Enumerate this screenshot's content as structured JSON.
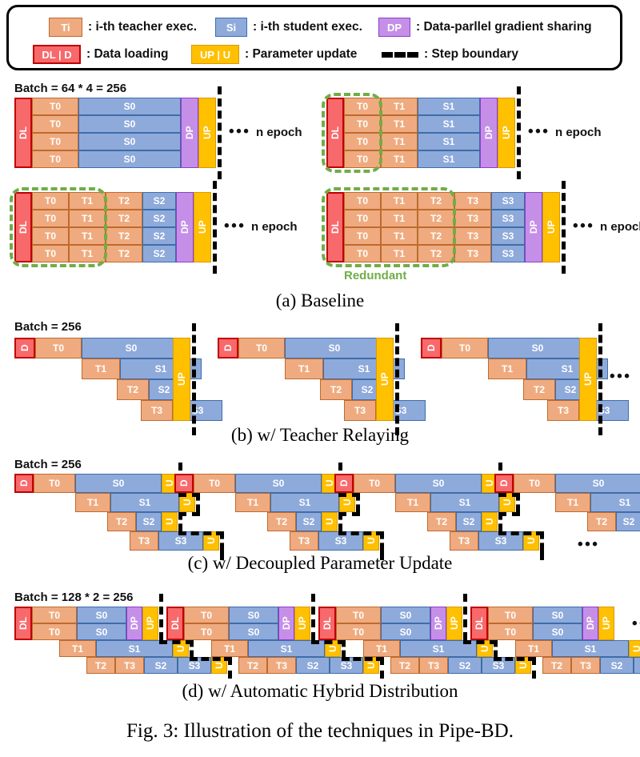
{
  "legend": {
    "row1": [
      {
        "chip": "Ti",
        "style": "t",
        "text": ": i-th teacher exec."
      },
      {
        "chip": "Si",
        "style": "s",
        "text": ": i-th student exec."
      },
      {
        "chip": "DP",
        "style": "dp",
        "text": ": Data-parllel gradient sharing"
      }
    ],
    "row2": [
      {
        "chip": "DL | D",
        "style": "dl",
        "text": ": Data loading"
      },
      {
        "chip": "UP | U",
        "style": "up",
        "text": ": Parameter update"
      },
      {
        "chip": "",
        "style": "dash",
        "text": ": Step boundary"
      }
    ]
  },
  "panels": {
    "a": {
      "caption": "(a) Baseline",
      "batch_label": "Batch = 64 * 4 = 256",
      "epoch_label": "n epoch",
      "dots": "•••",
      "redundant_label": "Redundant",
      "variants": [
        {
          "id": "a1",
          "teachers": [
            "T0"
          ],
          "student": "S0",
          "rows": 4,
          "dp": "DP",
          "up": "UP",
          "dl": "DL",
          "green_cols": 0
        },
        {
          "id": "a2",
          "teachers": [
            "T0",
            "T1"
          ],
          "student": "S1",
          "rows": 4,
          "dp": "DP",
          "up": "UP",
          "dl": "DL",
          "green_cols": 1
        },
        {
          "id": "a3",
          "teachers": [
            "T0",
            "T1",
            "T2"
          ],
          "student": "S2",
          "rows": 4,
          "dp": "DP",
          "up": "UP",
          "dl": "DL",
          "green_cols": 2
        },
        {
          "id": "a4",
          "teachers": [
            "T0",
            "T1",
            "T2",
            "T3"
          ],
          "student": "S3",
          "rows": 4,
          "dp": "DP",
          "up": "UP",
          "dl": "DL",
          "green_cols": 3
        }
      ]
    },
    "b": {
      "caption": "(b) w/ Teacher Relaying",
      "batch_label": "Batch = 256",
      "dots": "•••",
      "dl_label": "D",
      "up_label": "UP",
      "rows": [
        {
          "teacher": "T0",
          "student": "S0"
        },
        {
          "teacher": "T1",
          "student": "S1"
        },
        {
          "teacher": "T2",
          "student": "S2"
        },
        {
          "teacher": "T3",
          "student": "S3"
        }
      ]
    },
    "c": {
      "caption": "(c) w/ Decoupled Parameter Update",
      "batch_label": "Batch = 256",
      "dots": "•••",
      "dl_label": "D",
      "u_label": "U",
      "rows": [
        {
          "teacher": "T0",
          "student": "S0"
        },
        {
          "teacher": "T1",
          "student": "S1"
        },
        {
          "teacher": "T2",
          "student": "S2"
        },
        {
          "teacher": "T3",
          "student": "S3"
        }
      ]
    },
    "d": {
      "caption": "(d) w/ Automatic Hybrid Distribution",
      "batch_label": "Batch = 128 * 2 = 256",
      "dots": "•••",
      "dl_label": "DL",
      "dp_label": "DP",
      "up_label": "UP",
      "u_label": "U",
      "rows": [
        {
          "teacher": "T0",
          "student": "S0"
        },
        {
          "teacher": "T0",
          "student": "S0"
        },
        {
          "teacher": "T1",
          "student": "S1"
        },
        {
          "teachers": [
            "T2",
            "T3"
          ],
          "students": [
            "S2",
            "S3"
          ]
        }
      ]
    }
  },
  "figure_caption": "Fig. 3: Illustration of the techniques in Pipe-BD.",
  "colors": {
    "teacher": "#EFAB7F",
    "student": "#8EAADB",
    "data_loading": "#F8696B",
    "data_parallel": "#C58FE8",
    "param_update": "#FFC000",
    "redundant": "#70AD47",
    "boundary": "#000000"
  }
}
